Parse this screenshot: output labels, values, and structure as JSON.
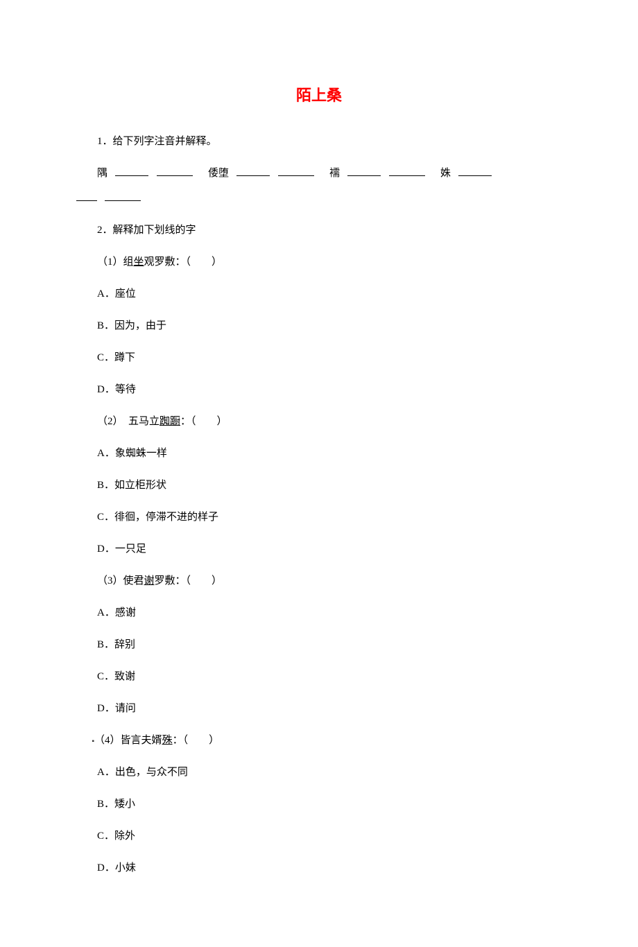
{
  "title": "陌上桑",
  "q1": {
    "prompt": "1．给下列字注音并解释。",
    "items": [
      {
        "word": "隅"
      },
      {
        "word": "倭堕"
      },
      {
        "word": "襦"
      },
      {
        "word": "姝"
      }
    ]
  },
  "q2": {
    "prompt": "2．解释加下划线的字",
    "sub1": {
      "stem_pre": "（1）组",
      "stem_u": "坐",
      "stem_post": "观罗敷：（　　）",
      "A": "A．座位",
      "B": "B．因为，由于",
      "C": "C．蹲下",
      "D": "D．等待"
    },
    "sub2": {
      "stem_pre": "（2）　五马立",
      "stem_u": "踟蹰",
      "stem_post": "：（　　）",
      "A": "A．象蜘蛛一样",
      "B": "B．如立柜形状",
      "C": "C．徘徊，停滞不进的样子",
      "D": "D．一只足"
    },
    "sub3": {
      "stem_pre": "（3）使君",
      "stem_u": "谢",
      "stem_post": "罗敷：（　　）",
      "A": "A．感谢",
      "B": "B．辞别",
      "C": "C．致谢",
      "D": "D．请问"
    },
    "sub4": {
      "stem_pre": "（4）皆言夫婿",
      "stem_u": "殊",
      "stem_post": "：（　　）",
      "A": "A．出色，与众不同",
      "B": "B．矮小",
      "C": "C．除外",
      "D": "D．小妹"
    }
  }
}
